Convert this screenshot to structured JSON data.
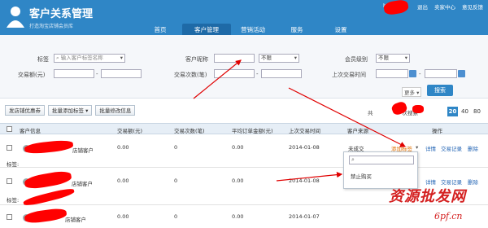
{
  "header": {
    "brand": "客户关系管理",
    "brand_sub": "打造淘宝店铺会员库",
    "user_prefix": "hi,",
    "logout": "退出",
    "seller_center": "卖家中心",
    "feedback": "意见反馈",
    "nav": [
      "首页",
      "客户管理",
      "营销活动",
      "服务",
      "设置"
    ],
    "active_nav": "客户管理"
  },
  "filter": {
    "tag_label": "标签",
    "tag_placeholder": "输入客户标签名称",
    "nickname_label": "客户昵称",
    "nickname_value": "",
    "nickname_option": "不限",
    "member_label": "会员级别",
    "member_option": "不限",
    "trade_amount_label": "交易额(元)",
    "trade_count_label": "交易次数(笔)",
    "last_trade_label": "上次交易时间",
    "more_label": "更多",
    "search_label": "搜索",
    "range_sep": "-"
  },
  "toolbar": {
    "coupon": "发店铺优惠券",
    "batch_tag": "批量添加标签",
    "batch_edit": "批量修改信息",
    "pager_text": "共",
    "pager_text2": "次搜索",
    "pages": [
      "20",
      "40",
      "80"
    ],
    "active_page": "20"
  },
  "table": {
    "headers": [
      "客户信息",
      "交易额(元)",
      "交易次数(笔)",
      "平均订单金额(元)",
      "上次交易时间",
      "客户来源",
      "操作"
    ],
    "rows": [
      {
        "name_suffix": "店铺客户",
        "amount": "0.00",
        "count": "0",
        "avg": "0.00",
        "last": "2014-01-08",
        "status": "未成交",
        "tag_label": "标签:",
        "add_tag": "添加标签",
        "detail": "详情",
        "trade": "交易记录",
        "delete": "删除"
      },
      {
        "name_suffix": "店铺客户",
        "amount": "0.00",
        "count": "0",
        "avg": "0.00",
        "last": "2014-01-08",
        "status": "",
        "tag_label": "标签:",
        "add_tag": "",
        "detail": "详情",
        "trade": "交易记录",
        "delete": "删除"
      },
      {
        "name_suffix": "店铺客户",
        "amount": "0.00",
        "count": "0",
        "avg": "0.00",
        "last": "2014-01-07",
        "status": "",
        "tag_label": "",
        "add_tag": "",
        "detail": "",
        "trade": "",
        "delete": ""
      }
    ]
  },
  "popup": {
    "item": "禁止购买"
  },
  "watermark": {
    "main": "资源批发网",
    "url": "6pf.cn"
  }
}
